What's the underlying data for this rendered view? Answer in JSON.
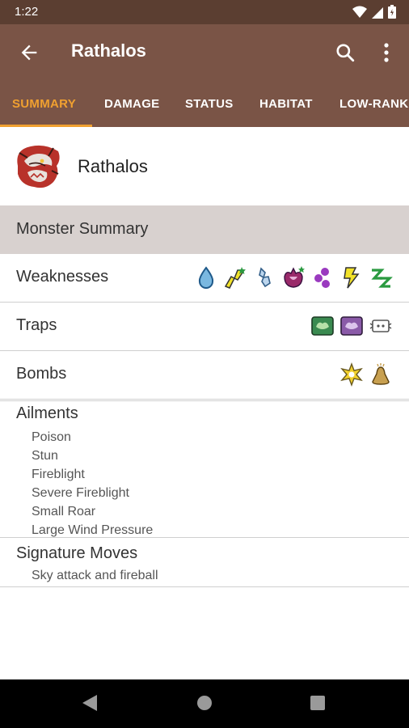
{
  "status_bar": {
    "time": "1:22"
  },
  "app_bar": {
    "title": "Rathalos"
  },
  "tabs": [
    {
      "label": "SUMMARY",
      "active": true
    },
    {
      "label": "DAMAGE",
      "active": false
    },
    {
      "label": "STATUS",
      "active": false
    },
    {
      "label": "HABITAT",
      "active": false
    },
    {
      "label": "LOW-RANK",
      "active": false
    }
  ],
  "monster": {
    "name": "Rathalos"
  },
  "summary": {
    "section_title": "Monster Summary",
    "weaknesses": {
      "label": "Weaknesses",
      "icons": [
        "water-weakness-icon",
        "thunder-weakness-star-icon",
        "ice-weakness-icon",
        "dragon-weakness-star-icon",
        "poison-weakness-icon",
        "stun-weakness-icon",
        "sleep-weakness-icon"
      ]
    },
    "traps": {
      "label": "Traps",
      "icons": [
        "pitfall-trap-icon",
        "shock-trap-icon",
        "flash-pod-icon"
      ]
    },
    "bombs": {
      "label": "Bombs",
      "icons": [
        "flash-bomb-icon",
        "sonic-bomb-icon"
      ]
    },
    "ailments": {
      "label": "Ailments",
      "items": [
        "Poison",
        "Stun",
        "Fireblight",
        "Severe Fireblight",
        "Small Roar",
        "Large Wind Pressure"
      ]
    },
    "signature_moves": {
      "label": "Signature Moves",
      "items": [
        "Sky attack and fireball"
      ]
    }
  },
  "colors": {
    "primary": "#7a5446",
    "primary_dark": "#5b3e31",
    "accent": "#f0a030",
    "section_bg": "#d8d1cf"
  }
}
